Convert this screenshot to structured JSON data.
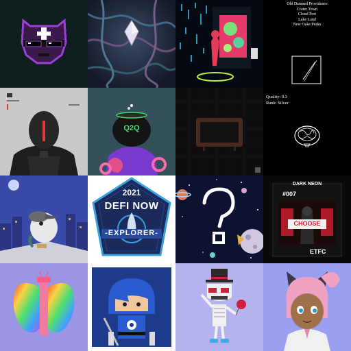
{
  "gallery": {
    "tiles": [
      {
        "id": "t1",
        "icon": "pixel-cat-with-sunglasses"
      },
      {
        "id": "t2",
        "icon": "abstract-tentacle-crystal"
      },
      {
        "id": "t3",
        "icon": "neon-gallery-room"
      },
      {
        "id": "t4",
        "icon": "minimal-line-frame",
        "places": [
          "Old Damned Providence",
          "Crater Town",
          "Cloud Port",
          "Lake Land",
          "New Oake Peaks"
        ]
      },
      {
        "id": "t5",
        "icon": "armored-helmet-figure"
      },
      {
        "id": "t6",
        "icon": "cauldron-head-character",
        "cauldron_text": "Q2Q"
      },
      {
        "id": "t7",
        "icon": "retro-tv"
      },
      {
        "id": "t8",
        "icon": "ramen-bowl-line-art",
        "quality_label": "Quality: 0.3",
        "rank_label": "Rank: Silver"
      },
      {
        "id": "t9",
        "icon": "bird-in-cap-cityscape"
      },
      {
        "id": "t10",
        "icon": "defi-badge",
        "year": "2021",
        "title": "DEFI NOW",
        "banner": "-EXPLORER-"
      },
      {
        "id": "t11",
        "icon": "question-mark-space"
      },
      {
        "id": "t12",
        "icon": "dark-neon-card",
        "header": "DARK NEON",
        "number": "#007",
        "footer": "ETFC",
        "sign": "CHOOSE"
      },
      {
        "id": "t13",
        "icon": "rainbow-butterfly-cake"
      },
      {
        "id": "t14",
        "icon": "blue-ninja-character"
      },
      {
        "id": "t15",
        "icon": "top-hat-skeleton"
      },
      {
        "id": "t16",
        "icon": "cat-ear-girl-avatar"
      }
    ]
  },
  "colors": {
    "neon_purple": "#9b3fd6",
    "defi_navy": "#1b2a5a",
    "lavender": "#9b95e4",
    "space_blue": "#0c1230"
  }
}
